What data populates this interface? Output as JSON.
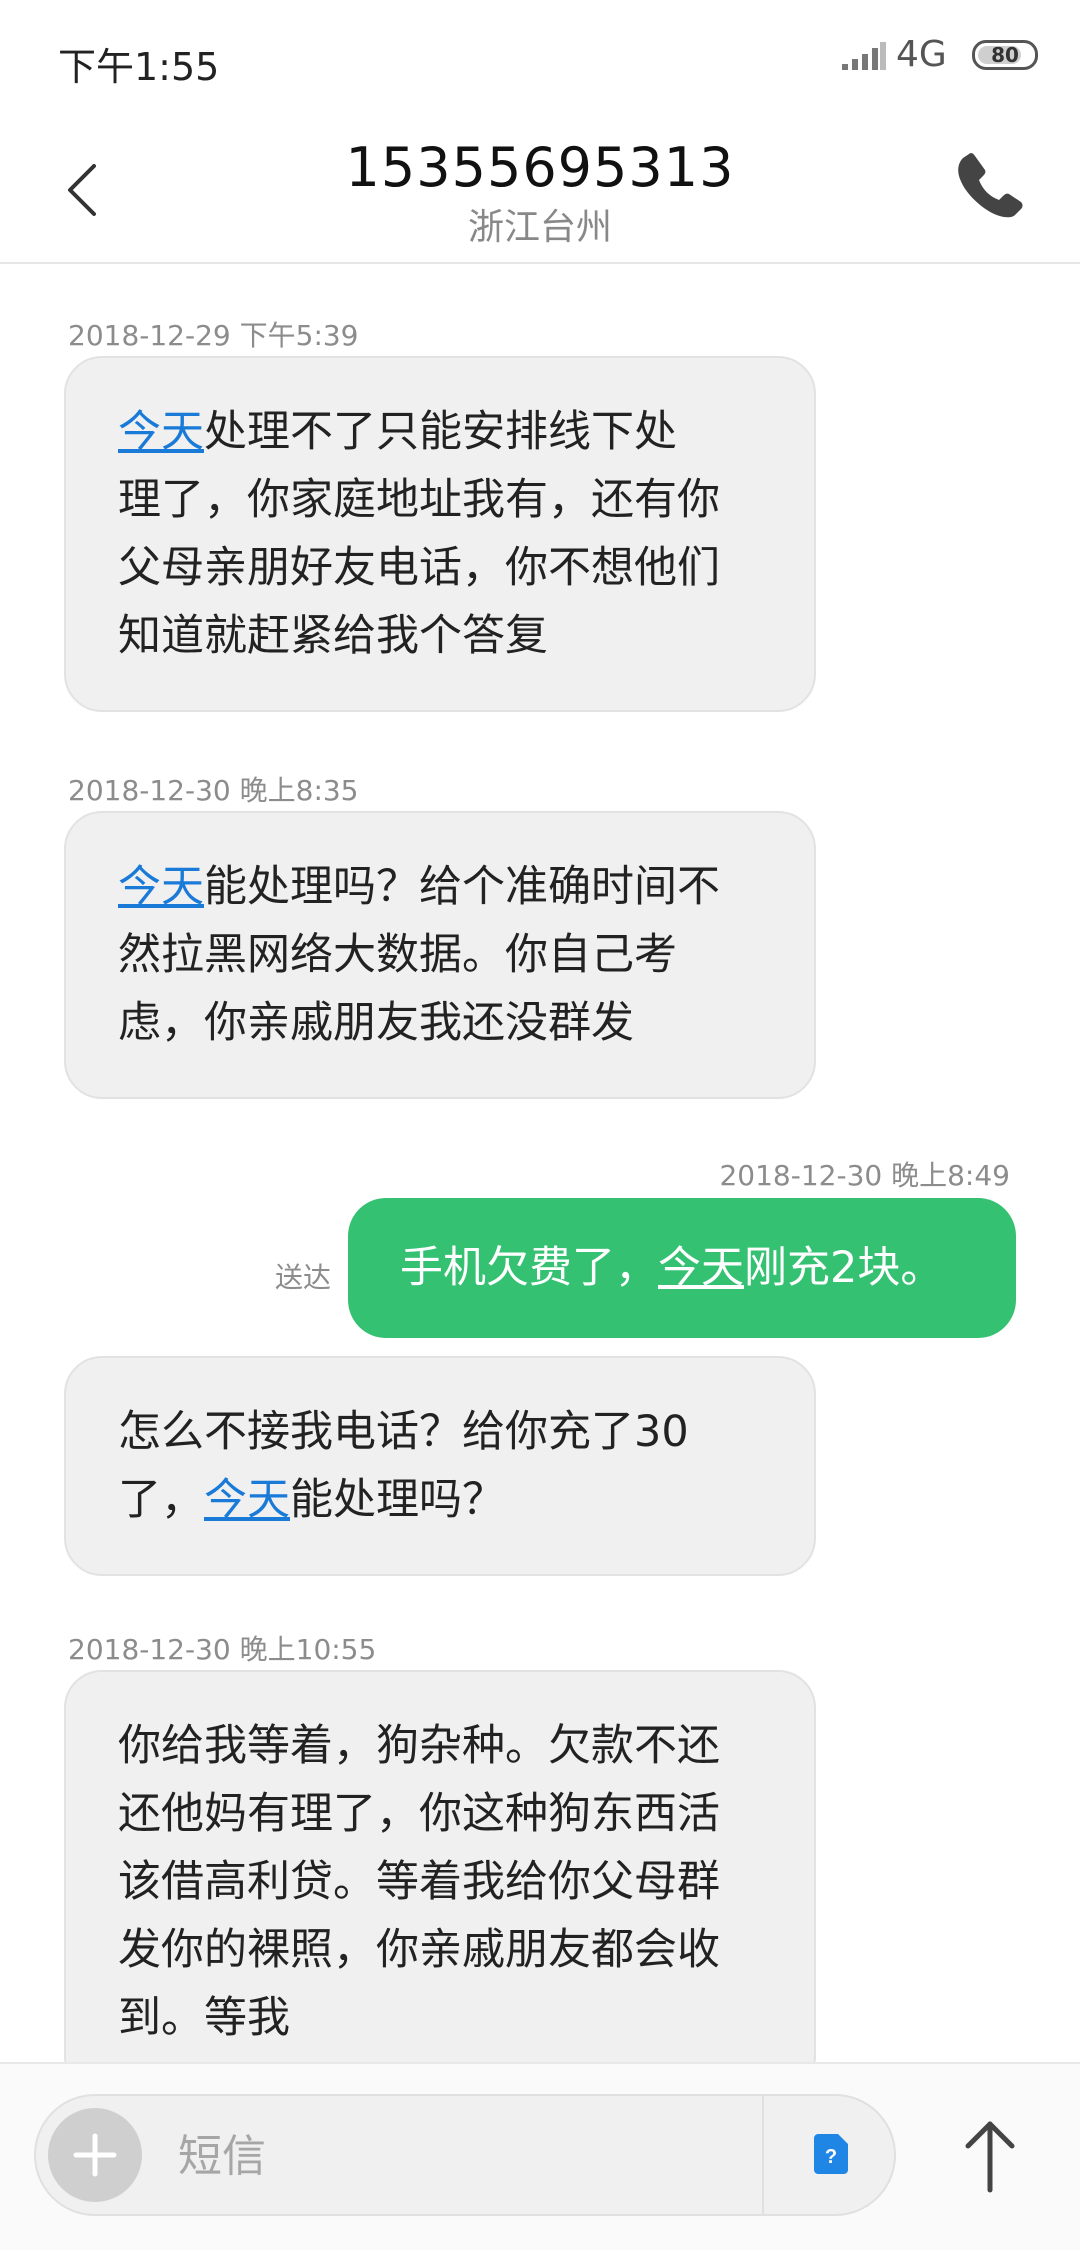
{
  "status_bar": {
    "time": "下午1:55",
    "network": "4G",
    "battery": "80",
    "battery_level": 0.8
  },
  "header": {
    "number": "15355695313",
    "region": "浙江台州"
  },
  "messages": {
    "ts1": "2018-12-29 下午5:39",
    "m1_link": "今天",
    "m1_line1": "处理不了只能安排线下处",
    "m1_line2": "理了，你家庭地址我有，还有你",
    "m1_line3": "父母亲朋好友电话，你不想他们",
    "m1_line4": "知道就赶紧给我个答复",
    "ts2": "2018-12-30 晚上8:35",
    "m2_link": "今天",
    "m2_line1": "能处理吗？给个准确时间不",
    "m2_line2": "然拉黑网络大数据。你自己考",
    "m2_line3": "虑，你亲戚朋友我还没群发",
    "ts3": "2018-12-30 晚上8:49",
    "m3_pre": "手机欠费了，",
    "m3_link": "今天",
    "m3_post": "刚充2块。",
    "m3_status": "送达",
    "m4_line1": "怎么不接我电话？给你充了30",
    "m4_pre": "了，",
    "m4_link": "今天",
    "m4_post": "能处理吗？",
    "ts4": "2018-12-30 晚上10:55",
    "m5_line1": "你给我等着，狗杂种。欠款不还",
    "m5_line2": "还他妈有理了，你这种狗东西活",
    "m5_line3": "该借高利贷。等着我给你父母群",
    "m5_line4": "发你的裸照，你亲戚朋友都会收",
    "m5_line5": "到。等我"
  },
  "compose": {
    "placeholder": "短信"
  },
  "colors": {
    "sent_bubble": "#34c172",
    "link": "#1a7ad8",
    "received_bubble": "#f0f0f0"
  },
  "icons": {
    "back": "chevron-left-icon",
    "call": "phone-icon",
    "add": "plus-icon",
    "sim": "sim-card-icon",
    "send": "arrow-up-icon"
  }
}
